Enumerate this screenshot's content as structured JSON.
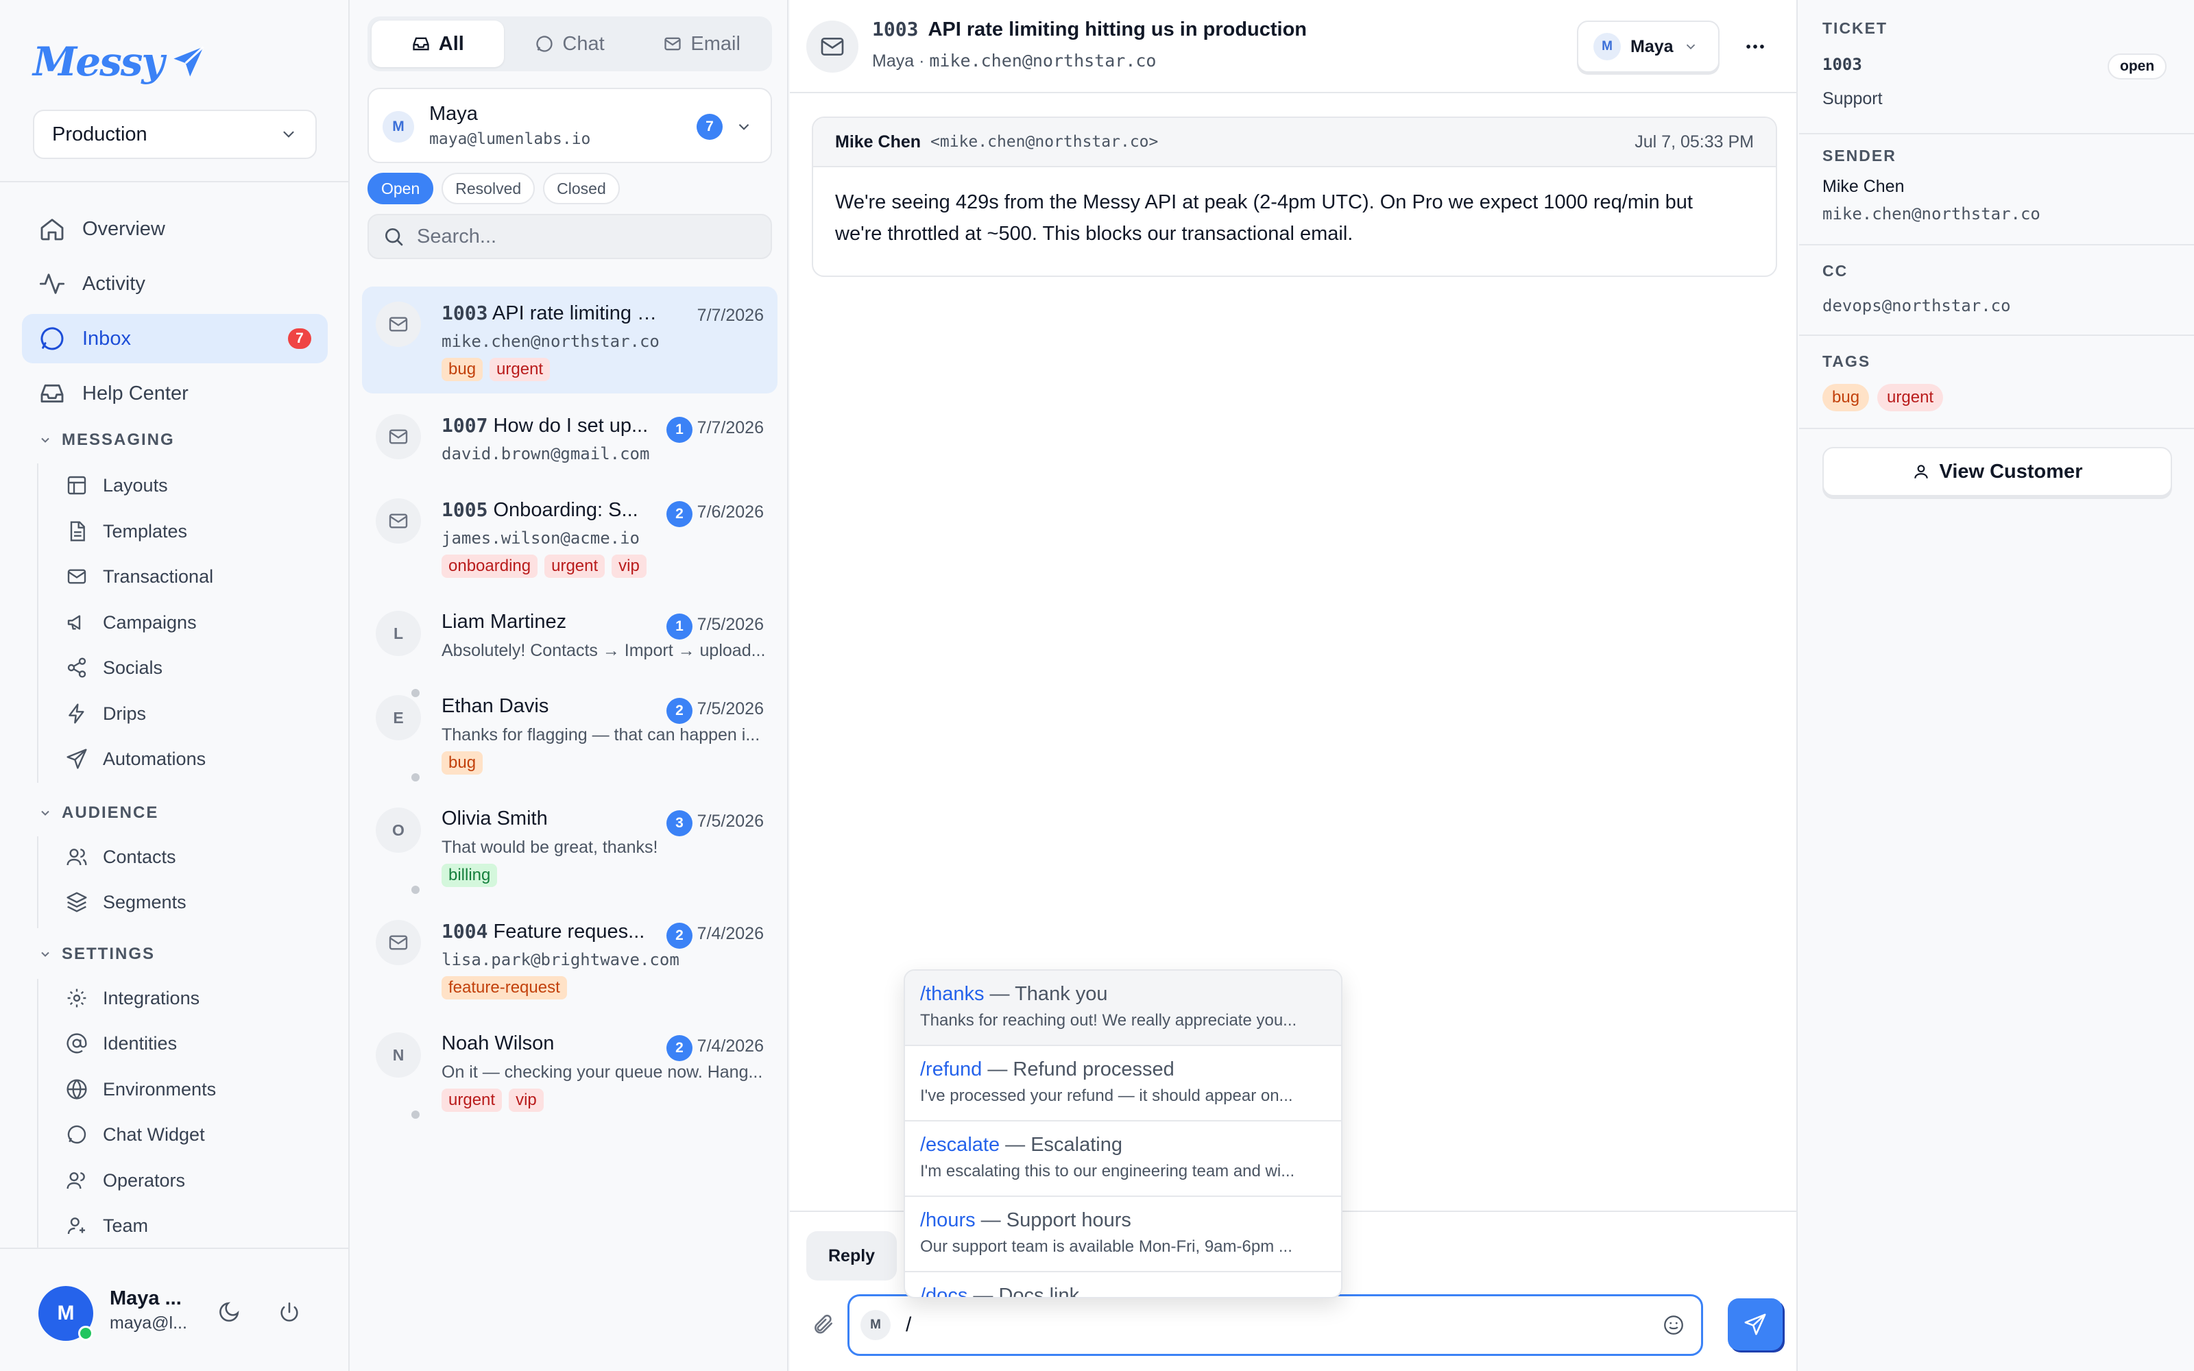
{
  "brand": {
    "name": "Messy",
    "logo_icon": "paper-plane-icon",
    "accent": "#3b82f6"
  },
  "environment": {
    "selected": "Production"
  },
  "nav": {
    "overview": "Overview",
    "activity": "Activity",
    "inbox": "Inbox",
    "inbox_count": "7",
    "help_center": "Help Center"
  },
  "sections": {
    "messaging": {
      "title": "MESSAGING",
      "items": [
        "Layouts",
        "Templates",
        "Transactional",
        "Campaigns",
        "Socials",
        "Drips",
        "Automations"
      ]
    },
    "audience": {
      "title": "AUDIENCE",
      "items": [
        "Contacts",
        "Segments"
      ]
    },
    "settings": {
      "title": "SETTINGS",
      "items": [
        "Integrations",
        "Identities",
        "Environments",
        "Chat Widget",
        "Operators",
        "Team"
      ]
    }
  },
  "current_user": {
    "initial": "M",
    "name": "Maya ...",
    "email": "maya@l..."
  },
  "channel_tabs": [
    "All",
    "Chat",
    "Email"
  ],
  "operator": {
    "initial": "M",
    "name": "Maya",
    "email": "maya@lumenlabs.io",
    "count": "7"
  },
  "status_tabs": [
    "Open",
    "Resolved",
    "Closed"
  ],
  "search": {
    "placeholder": "Search..."
  },
  "conversations": [
    {
      "number": "1003",
      "title": "API rate limiting hit...",
      "sub": "mike.chen@northstar.co",
      "date": "7/7/2026",
      "unread": "",
      "tags": [
        "bug",
        "urgent"
      ]
    },
    {
      "number": "1007",
      "title": "How do I set up...",
      "sub": "david.brown@gmail.com",
      "date": "7/7/2026",
      "unread": "1",
      "tags": []
    },
    {
      "number": "1005",
      "title": "Onboarding: S...",
      "sub": "james.wilson@acme.io",
      "date": "7/6/2026",
      "unread": "2",
      "tags": [
        "onboarding",
        "urgent",
        "vip"
      ]
    },
    {
      "initial": "L",
      "title": "Liam Martinez",
      "sub": "Absolutely! Contacts → Import → upload...",
      "date": "7/5/2026",
      "unread": "1",
      "tags": []
    },
    {
      "initial": "E",
      "title": "Ethan Davis",
      "sub": "Thanks for flagging — that can happen i...",
      "date": "7/5/2026",
      "unread": "2",
      "tags": [
        "bug"
      ]
    },
    {
      "initial": "O",
      "title": "Olivia Smith",
      "sub": "That would be great, thanks!",
      "date": "7/5/2026",
      "unread": "3",
      "tags": [
        "billing"
      ]
    },
    {
      "number": "1004",
      "title": "Feature reques...",
      "sub": "lisa.park@brightwave.com",
      "date": "7/4/2026",
      "unread": "2",
      "tags": [
        "feature-request"
      ]
    },
    {
      "initial": "N",
      "title": "Noah Wilson",
      "sub": "On it — checking your queue now. Hang...",
      "date": "7/4/2026",
      "unread": "2",
      "tags": [
        "urgent",
        "vip"
      ]
    }
  ],
  "thread": {
    "number": "1003",
    "title": "API rate limiting hitting us in production",
    "assignee": "Maya",
    "meta_prefix": "Maya · ",
    "meta_email": "mike.chen@northstar.co",
    "assign_initial": "M"
  },
  "message": {
    "from_name": "Mike Chen",
    "from_addr": "<mike.chen@northstar.co>",
    "time": "Jul 7, 05:33 PM",
    "body": "We're seeing 429s from the Messy API at peak (2-4pm UTC). On Pro we expect 1000 req/min but we're throttled at ~500. This blocks our transactional email."
  },
  "composer": {
    "tab": "Reply",
    "initial": "M",
    "value": "/"
  },
  "slash_commands": [
    {
      "cmd": "/thanks",
      "label": "Thank you",
      "preview": "Thanks for reaching out! We really appreciate you..."
    },
    {
      "cmd": "/refund",
      "label": "Refund processed",
      "preview": "I've processed your refund — it should appear on..."
    },
    {
      "cmd": "/escalate",
      "label": "Escalating",
      "preview": "I'm escalating this to our engineering team and wi..."
    },
    {
      "cmd": "/hours",
      "label": "Support hours",
      "preview": "Our support team is available Mon-Fri, 9am-6pm ..."
    },
    {
      "cmd": "/docs",
      "label": "Docs link",
      "preview": ""
    }
  ],
  "details": {
    "ticket_label": "TICKET",
    "ticket_number": "1003",
    "ticket_status": "open",
    "ticket_type": "Support",
    "sender_label": "SENDER",
    "sender_name": "Mike Chen",
    "sender_email": "mike.chen@northstar.co",
    "cc_label": "CC",
    "cc_value": "devops@northstar.co",
    "tags_label": "TAGS",
    "tags": [
      "bug",
      "urgent"
    ],
    "view_customer": "View Customer"
  },
  "tag_colors": {
    "bug": "orange",
    "urgent": "red",
    "vip": "red",
    "onboarding": "red",
    "billing": "green",
    "feature-request": "orange"
  }
}
